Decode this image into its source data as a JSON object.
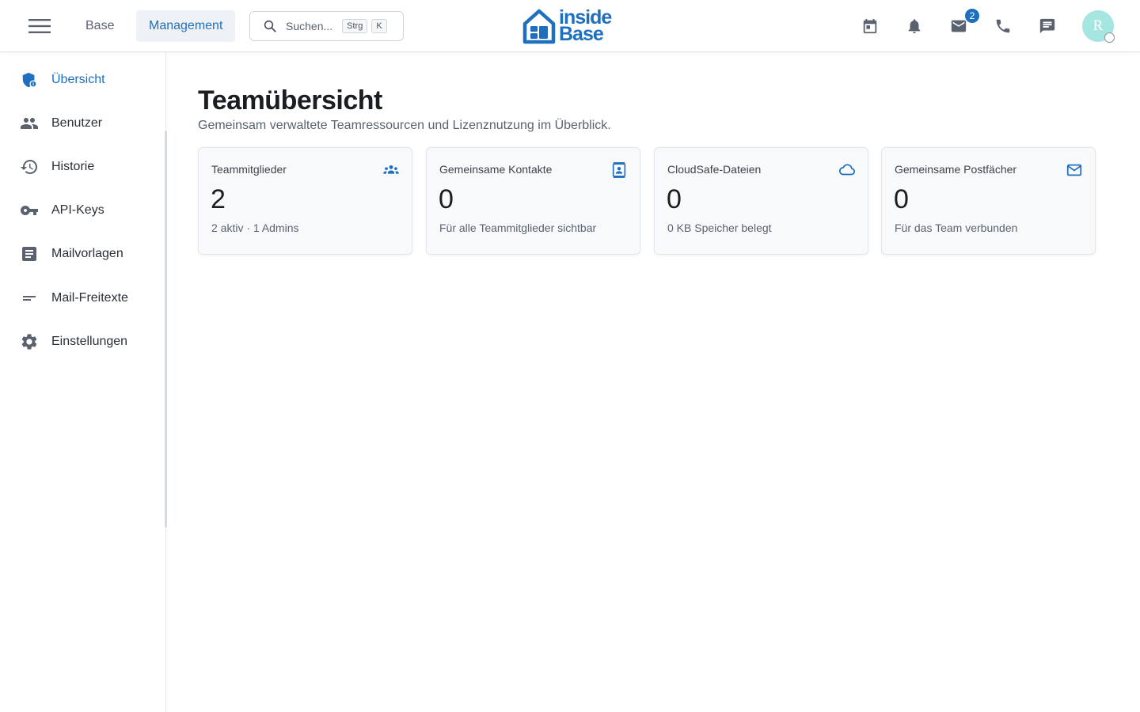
{
  "header": {
    "tabs": [
      {
        "label": "Base"
      },
      {
        "label": "Management"
      }
    ],
    "search": {
      "placeholder": "Suchen...",
      "shortcut_key1": "Strg",
      "shortcut_key2": "K"
    },
    "logo": {
      "line1": "inside",
      "line2": "Base"
    },
    "mail_badge": "2",
    "avatar_initial": "R"
  },
  "sidebar": {
    "items": [
      {
        "label": "Übersicht",
        "icon": "shield-icon"
      },
      {
        "label": "Benutzer",
        "icon": "people-icon"
      },
      {
        "label": "Historie",
        "icon": "history-icon"
      },
      {
        "label": "API-Keys",
        "icon": "key-icon"
      },
      {
        "label": "Mailvorlagen",
        "icon": "document-icon"
      },
      {
        "label": "Mail-Freitexte",
        "icon": "short-text-icon"
      },
      {
        "label": "Einstellungen",
        "icon": "gear-icon"
      }
    ]
  },
  "main": {
    "title": "Teamübersicht",
    "subtitle": "Gemeinsam verwaltete Teamressourcen und Lizenznutzung im Überblick.",
    "cards": [
      {
        "title": "Teammitglieder",
        "value": "2",
        "sub": "2 aktiv · 1 Admins",
        "icon": "groups-icon"
      },
      {
        "title": "Gemeinsame Kontakte",
        "value": "0",
        "sub": "Für alle Teammitglieder sichtbar",
        "icon": "contact-card-icon"
      },
      {
        "title": "CloudSafe-Dateien",
        "value": "0",
        "sub": "0 KB Speicher belegt",
        "icon": "cloud-icon"
      },
      {
        "title": "Gemeinsame Postfächer",
        "value": "0",
        "sub": "Für das Team verbunden",
        "icon": "mail-icon"
      }
    ]
  },
  "colors": {
    "accent": "#1f6fbf",
    "avatar_bg": "#a6e6e0"
  }
}
